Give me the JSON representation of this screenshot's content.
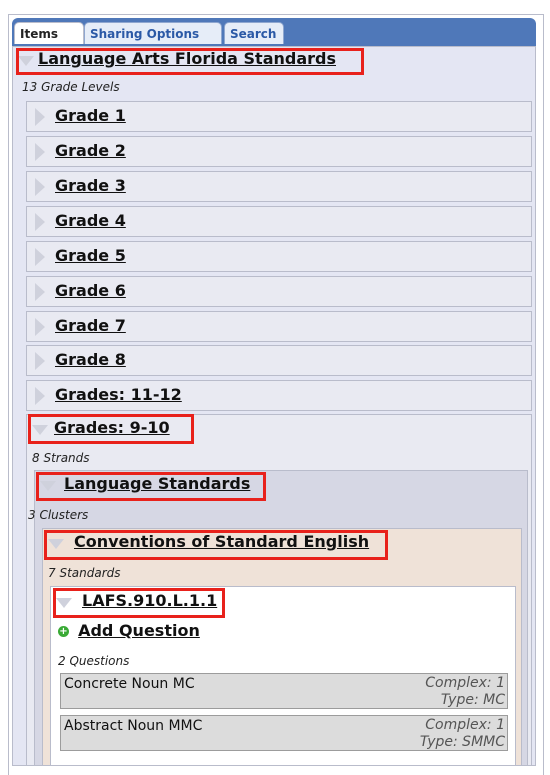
{
  "tabs": [
    {
      "label": "Items"
    },
    {
      "label": "Sharing Options"
    },
    {
      "label": "Search"
    }
  ],
  "root": {
    "title": "Language Arts Florida Standards",
    "count": "13 Grade Levels"
  },
  "grades": [
    {
      "label": "Grade 1"
    },
    {
      "label": "Grade 2"
    },
    {
      "label": "Grade 3"
    },
    {
      "label": "Grade 4"
    },
    {
      "label": "Grade 5"
    },
    {
      "label": "Grade 6"
    },
    {
      "label": "Grade 7"
    },
    {
      "label": "Grade 8"
    },
    {
      "label": "Grades: 11-12"
    }
  ],
  "expanded_grade": {
    "label": "Grades: 9-10",
    "count": "8 Strands"
  },
  "strand": {
    "label": "Language Standards",
    "count": "3 Clusters"
  },
  "cluster": {
    "label": "Conventions of Standard English",
    "count": "7 Standards"
  },
  "standard": {
    "label": "LAFS.910.L.1.1",
    "add_question": "Add Question",
    "count": "2 Questions"
  },
  "questions": [
    {
      "name": "Concrete Noun MC",
      "complexity": "Complex: 1",
      "type": "Type: MC"
    },
    {
      "name": "Abstract Noun MMC",
      "complexity": "Complex: 1",
      "type": "Type: SMMC"
    }
  ],
  "colors": {
    "tab_bar": "#4f78b9",
    "highlight": "#e8211b",
    "panel": "#e4e6f3",
    "cluster_bg": "#efe2d8",
    "add_icon": "#3aaa35"
  }
}
